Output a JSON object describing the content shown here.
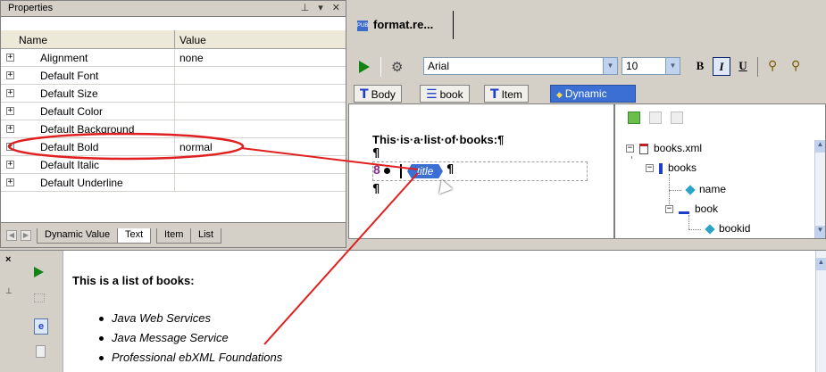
{
  "properties_panel": {
    "title": "Properties",
    "pin_glyph": "⊥",
    "dropdown_glyph": "▾",
    "close_glyph": "✕",
    "columns": {
      "name": "Name",
      "value": "Value"
    },
    "rows": [
      {
        "name": "Alignment",
        "value": "none"
      },
      {
        "name": "Default Font",
        "value": ""
      },
      {
        "name": "Default Size",
        "value": ""
      },
      {
        "name": "Default Color",
        "value": ""
      },
      {
        "name": "Default Background",
        "value": ""
      },
      {
        "name": "Default Bold",
        "value": "normal"
      },
      {
        "name": "Default Italic",
        "value": ""
      },
      {
        "name": "Default Underline",
        "value": ""
      }
    ],
    "expand_glyph": "+",
    "tabs": [
      "Dynamic Value",
      "Text",
      "Item",
      "List"
    ],
    "active_tab": "Text"
  },
  "document_tab": {
    "label": "format.re...",
    "icon_text": "PUB"
  },
  "toolbar": {
    "font": "Arial",
    "size": "10",
    "bold": "B",
    "italic": "I",
    "underline": "U",
    "dropdown_glyph": "▼"
  },
  "section_bar": {
    "items": [
      {
        "glyph": "T",
        "label": "Body"
      },
      {
        "glyph": "☰",
        "label": "book"
      },
      {
        "glyph": "T",
        "label": "Item"
      },
      {
        "glyph": "◆",
        "label": "Dynamic"
      }
    ]
  },
  "design": {
    "heading": "This·is·a·list·of·books:¶",
    "pilcrow": "¶",
    "list_marker": "8",
    "field_chip": "title"
  },
  "schema_tree": {
    "nodes": [
      {
        "label": "books.xml",
        "expand": "−"
      },
      {
        "label": "books",
        "expand": "−"
      },
      {
        "label": "name",
        "expand": ""
      },
      {
        "label": "book",
        "expand": "−"
      },
      {
        "label": "bookid",
        "expand": ""
      }
    ]
  },
  "preview": {
    "close_glyph": "×",
    "heading": "This is a list of books:",
    "items": [
      "Java Web Services",
      "Java Message Service",
      "Professional ebXML Foundations"
    ]
  },
  "colors": {
    "annotation": "#e02020",
    "accent": "#3b6fd4"
  }
}
